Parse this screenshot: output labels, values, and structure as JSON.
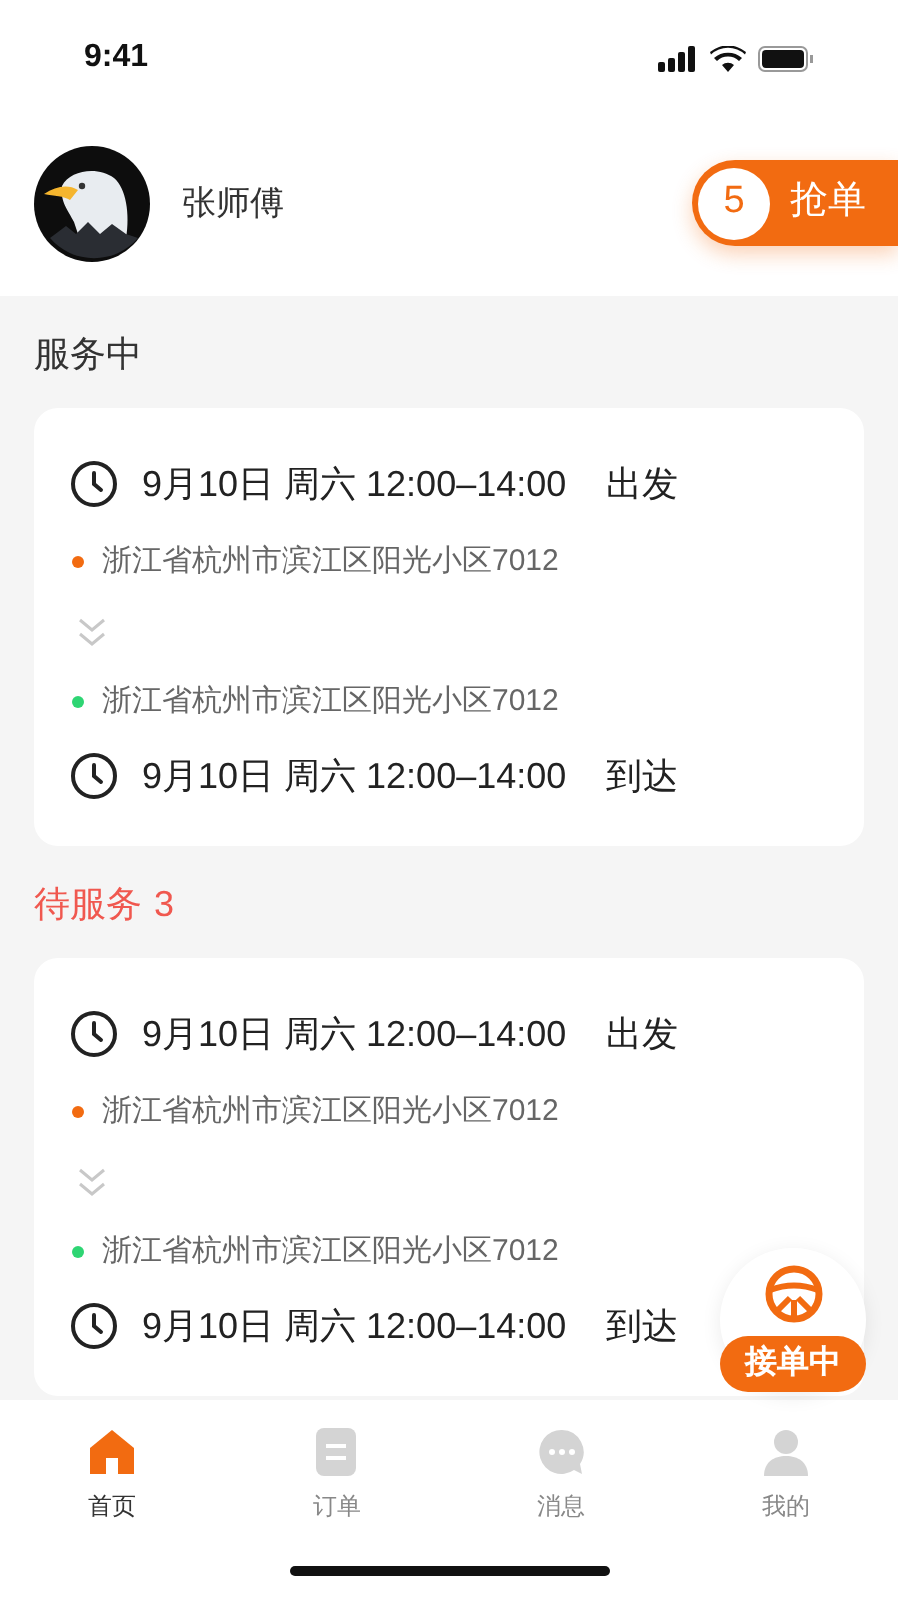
{
  "status_bar": {
    "time": "9:41"
  },
  "header": {
    "name": "张师傅",
    "grab": {
      "count": "5",
      "label": "抢单"
    }
  },
  "sections": [
    {
      "kind": "active",
      "title": "服务中",
      "orders": [
        {
          "depart": {
            "time": "9月10日 周六 12:00–14:00",
            "action": "出发"
          },
          "from": {
            "address": "浙江省杭州市滨江区阳光小区7012",
            "color": "#f26b11"
          },
          "to": {
            "address": "浙江省杭州市滨江区阳光小区7012",
            "color": "#2ed573"
          },
          "arrive": {
            "time": "9月10日 周六 12:00–14:00",
            "action": "到达"
          }
        }
      ]
    },
    {
      "kind": "pending",
      "title": "待服务",
      "count": "3",
      "orders": [
        {
          "depart": {
            "time": "9月10日 周六 12:00–14:00",
            "action": "出发"
          },
          "from": {
            "address": "浙江省杭州市滨江区阳光小区7012",
            "color": "#f26b11"
          },
          "to": {
            "address": "浙江省杭州市滨江区阳光小区7012",
            "color": "#2ed573"
          },
          "arrive": {
            "time": "9月10日 周六 12:00–14:00",
            "action": "到达"
          }
        }
      ]
    }
  ],
  "floating": {
    "label": "接单中"
  },
  "tabs": [
    {
      "label": "首页",
      "selected": true
    },
    {
      "label": "订单",
      "selected": false
    },
    {
      "label": "消息",
      "selected": false
    },
    {
      "label": "我的",
      "selected": false
    }
  ]
}
